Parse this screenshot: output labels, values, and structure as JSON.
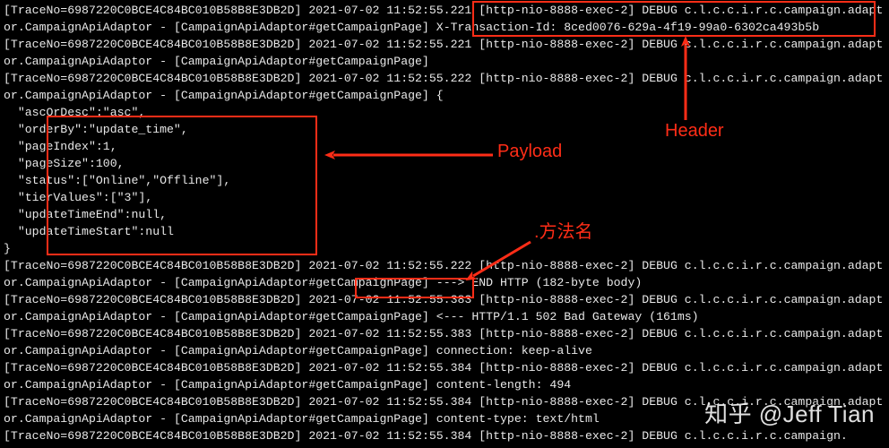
{
  "log": {
    "trace_no": "6987220C0BCE4C84BC010B58B8E3DB2D",
    "date": "2021-07-02",
    "thread": "[http-nio-8888-exec-2]",
    "level": "DEBUG",
    "logger": "c.l.c.c.i.r.c.campaign.adaptor.CampaignApiAdaptor",
    "method_tag": "[CampaignApiAdaptor#getCampaignPage]",
    "l1_time": "11:52:55.221",
    "l1_tail": "X-Transaction-Id: 8ced0076-629a-4f19-99a0-6302ca493b5b",
    "l2_time": "11:52:55.221",
    "l3_time": "11:52:55.222",
    "l3_brace": "{",
    "json_lines": [
      "  \"ascOrDesc\":\"asc\",",
      "  \"orderBy\":\"update_time\",",
      "  \"pageIndex\":1,",
      "  \"pageSize\":100,",
      "  \"status\":[\"Online\",\"Offline\"],",
      "  \"tierValues\":[\"3\"],",
      "  \"updateTimeEnd\":null,",
      "  \"updateTimeStart\":null"
    ],
    "close_brace": "}",
    "l4_time": "11:52:55.222",
    "l4_tail": "---> END HTTP (182-byte body)",
    "l5_time": "11:52:55.383",
    "l5_tail": "<--- HTTP/1.1 502 Bad Gateway (161ms)",
    "l6_time": "11:52:55.383",
    "l6_tail": "connection: keep-alive",
    "l7_time": "11:52:55.384",
    "l7_tail": "content-length: 494",
    "l8_time": "11:52:55.384",
    "l8_tail": "content-type: text/html",
    "l9_time": "11:52:55.384"
  },
  "annotations": {
    "header_label": "Header",
    "payload_label": "Payload",
    "method_label": ".方法名"
  },
  "watermark": "知乎 @Jeff Tian"
}
